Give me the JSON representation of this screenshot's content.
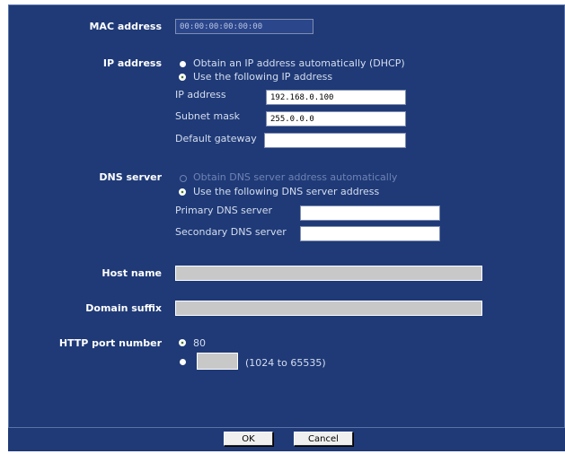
{
  "mac": {
    "label": "MAC address",
    "value": "00:00:00:00:00:00"
  },
  "ip": {
    "label": "IP address",
    "opt_dhcp": "Obtain an IP address automatically (DHCP)",
    "opt_static": "Use the following IP address",
    "ip_label": "IP address",
    "ip_value": "192.168.0.100",
    "mask_label": "Subnet mask",
    "mask_value": "255.0.0.0",
    "gw_label": "Default gateway",
    "gw_value": ""
  },
  "dns": {
    "label": "DNS server",
    "opt_auto": "Obtain DNS server address automatically",
    "opt_manual": "Use the following DNS server address",
    "primary_label": "Primary DNS server",
    "primary_value": "",
    "secondary_label": "Secondary DNS server",
    "secondary_value": ""
  },
  "host": {
    "label": "Host name",
    "value": ""
  },
  "domain": {
    "label": "Domain suffix",
    "value": ""
  },
  "http": {
    "label": "HTTP port number",
    "opt_default": "80",
    "custom_value": "",
    "range_hint": "(1024 to 65535)"
  },
  "buttons": {
    "ok": "OK",
    "cancel": "Cancel"
  },
  "colors": {
    "panel_bg": "#1f3a77",
    "selected_radio": "#d7f0a0"
  }
}
